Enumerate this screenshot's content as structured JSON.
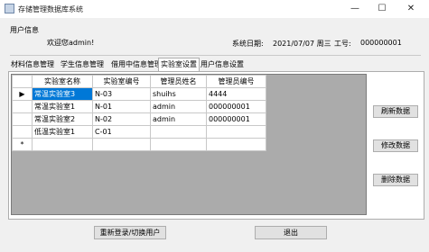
{
  "window": {
    "title": "存储管理数据库系统",
    "min_glyph": "—",
    "max_glyph": "☐",
    "close_glyph": "✕"
  },
  "user_info": {
    "group_label": "用户信息",
    "welcome": "欢迎您admin!",
    "date_label": "系统日期:",
    "date_value": "2021/07/07 周三",
    "id_label": "工号:",
    "id_value": "000000001"
  },
  "tabs": [
    {
      "label": "材料信息管理"
    },
    {
      "label": "学生信息管理"
    },
    {
      "label": "借用中信息管理"
    },
    {
      "label": "实验室设置",
      "active": true
    },
    {
      "label": "用户信息设置"
    }
  ],
  "grid": {
    "columns": [
      "实验室名称",
      "实验室编号",
      "管理员姓名",
      "管理员编号"
    ],
    "rows": [
      {
        "marker": "▶",
        "cells": [
          "常温实验室3",
          "N-03",
          "shuihs",
          "4444"
        ]
      },
      {
        "marker": "",
        "cells": [
          "常温实验室1",
          "N-01",
          "admin",
          "000000001"
        ]
      },
      {
        "marker": "",
        "cells": [
          "常温实验室2",
          "N-02",
          "admin",
          "000000001"
        ]
      },
      {
        "marker": "",
        "cells": [
          "低温实验室1",
          "C-01",
          "",
          ""
        ]
      },
      {
        "marker": "*",
        "cells": [
          "",
          "",
          "",
          ""
        ]
      }
    ]
  },
  "side_buttons": {
    "refresh": "刷新数据",
    "edit": "修改数据",
    "delete": "删除数据"
  },
  "bottom_buttons": {
    "relogin": "重新登录/切换用户",
    "exit": "退出"
  },
  "colors": {
    "selection": "#0078d7",
    "grid_background": "#ababab",
    "window_background": "#f0f0f0"
  }
}
